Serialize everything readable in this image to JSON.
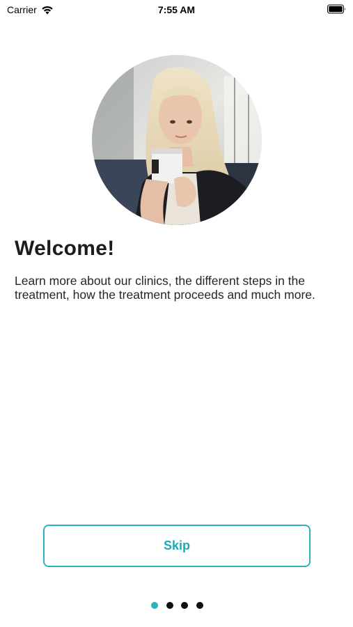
{
  "status_bar": {
    "carrier": "Carrier",
    "time": "7:55 AM"
  },
  "onboarding": {
    "hero_icon": "woman-holding-coffee-photo",
    "title": "Welcome!",
    "description": "Learn more about our clinics, the different steps in the treatment, how the treatment proceeds and much more.",
    "skip_label": "Skip",
    "page_count": 4,
    "current_page": 1
  },
  "colors": {
    "accent": "#2bb3bc",
    "dot_inactive": "#111111",
    "text": "#1c1c1c"
  }
}
